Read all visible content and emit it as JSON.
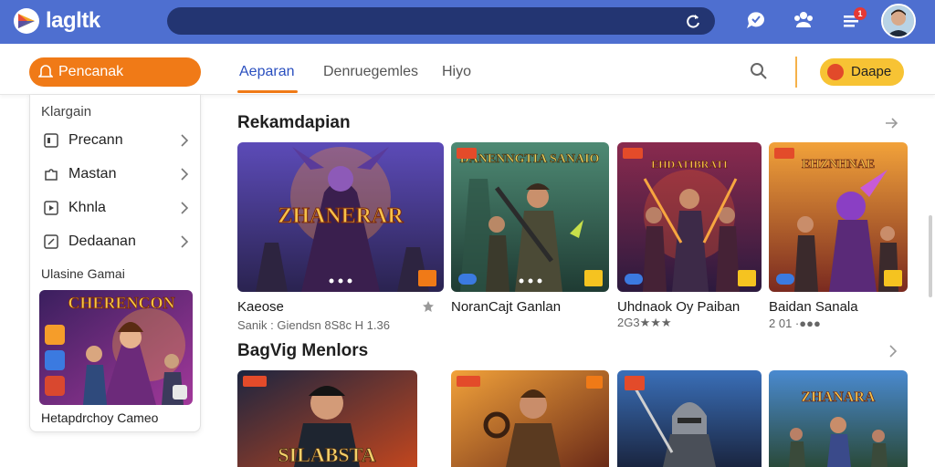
{
  "app": {
    "brand": "lagltk",
    "colors": {
      "topbar": "#4e6fd0",
      "accent": "#f07a17",
      "active_tab": "#2a4fbf",
      "pill": "#f7c334"
    }
  },
  "topbar": {
    "search_value": "",
    "icons": [
      "refresh-icon",
      "chat-icon",
      "group-icon",
      "menu-icon"
    ],
    "notification_count": "1"
  },
  "subbar": {
    "primary_button": "Pencanak",
    "tabs": [
      {
        "label": "Aeparan",
        "active": true
      },
      {
        "label": "Denruegemles",
        "active": false
      },
      {
        "label": "Hiyo",
        "active": false
      }
    ],
    "pill_button": "Daape"
  },
  "sidebar": {
    "heading": "Klargain",
    "items": [
      {
        "label": "Precann",
        "icon": "square-icon"
      },
      {
        "label": "Mastan",
        "icon": "puzzle-icon"
      },
      {
        "label": "Khnla",
        "icon": "play-icon"
      },
      {
        "label": "Dedaanan",
        "icon": "edit-icon"
      }
    ],
    "subheading": "Ulasine Gamai",
    "card_title": "CHERENCON",
    "caption": "Hetapdrchoy Cameo"
  },
  "sections": [
    {
      "title": "Rekamdapian",
      "cards": [
        {
          "art_title": "ZHANERAR",
          "title": "Kaeose",
          "sub": "Sanik : Giendsn 8S8c H 1.36"
        },
        {
          "art_title": "DANENNGTIA SANAIO",
          "title": "NoranCajt Ganlan",
          "sub": ""
        },
        {
          "art_title": "EHDATIBRATI",
          "title": "Uhdnaok Oy Paiban",
          "sub": "2G3★★★"
        },
        {
          "art_title": "EHZNHNAE",
          "title": "Baidan Sanala",
          "sub": "2 01 ·●●●"
        }
      ]
    },
    {
      "title": "BagVig Menlors",
      "cards": [
        {
          "art_title": "SILABSTA"
        },
        {
          "art_title": ""
        },
        {
          "art_title": ""
        },
        {
          "art_title": "ZHANARA"
        }
      ]
    }
  ]
}
